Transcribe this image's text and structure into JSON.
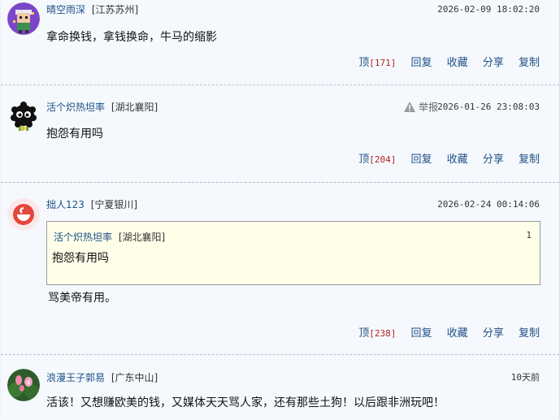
{
  "comments": [
    {
      "username": "晴空雨深",
      "location": "[江苏苏州]",
      "time": "2026-02-09 18:02:20",
      "content": "拿命换钱，拿钱换命，牛马的缩影",
      "actions": {
        "top_label": "顶",
        "top_count": "[171]",
        "reply": "回复",
        "favorite": "收藏",
        "share": "分享",
        "copy": "复制"
      }
    },
    {
      "username": "活个炽热坦率",
      "location": "[湖北襄阳]",
      "report_label": "举报",
      "time": "2026-01-26 23:08:03",
      "content": "抱怨有用吗",
      "actions": {
        "top_label": "顶",
        "top_count": "[204]",
        "reply": "回复",
        "favorite": "收藏",
        "share": "分享",
        "copy": "复制"
      }
    },
    {
      "username": "拙人123",
      "location": "[宁夏银川]",
      "time": "2026-02-24 00:14:06",
      "quote": {
        "username": "活个炽热坦率",
        "location": "[湖北襄阳]",
        "floor": "1",
        "content": "抱怨有用吗"
      },
      "content": "骂美帝有用。",
      "actions": {
        "top_label": "顶",
        "top_count": "[238]",
        "reply": "回复",
        "favorite": "收藏",
        "share": "分享",
        "copy": "复制"
      }
    },
    {
      "username": "浪漫王子郭易",
      "location": "[广东中山]",
      "time": "10天前",
      "content": "活该！又想赚欧美的钱，又媒体天天骂人家，还有那些土狗！以后跟非洲玩吧！"
    }
  ],
  "colors": {
    "background": "#f5f9fd",
    "username": "#1f4f86",
    "count": "#b22222",
    "quote_background": "#ffffe9"
  },
  "icons": {
    "avatar_1": "pixel-character-avatar",
    "avatar_2": "black-soot-sprite-avatar",
    "avatar_3": "red-swirl-logo-avatar",
    "avatar_4": "pink-lotus-flower-avatar",
    "report": "warning-triangle-icon"
  }
}
